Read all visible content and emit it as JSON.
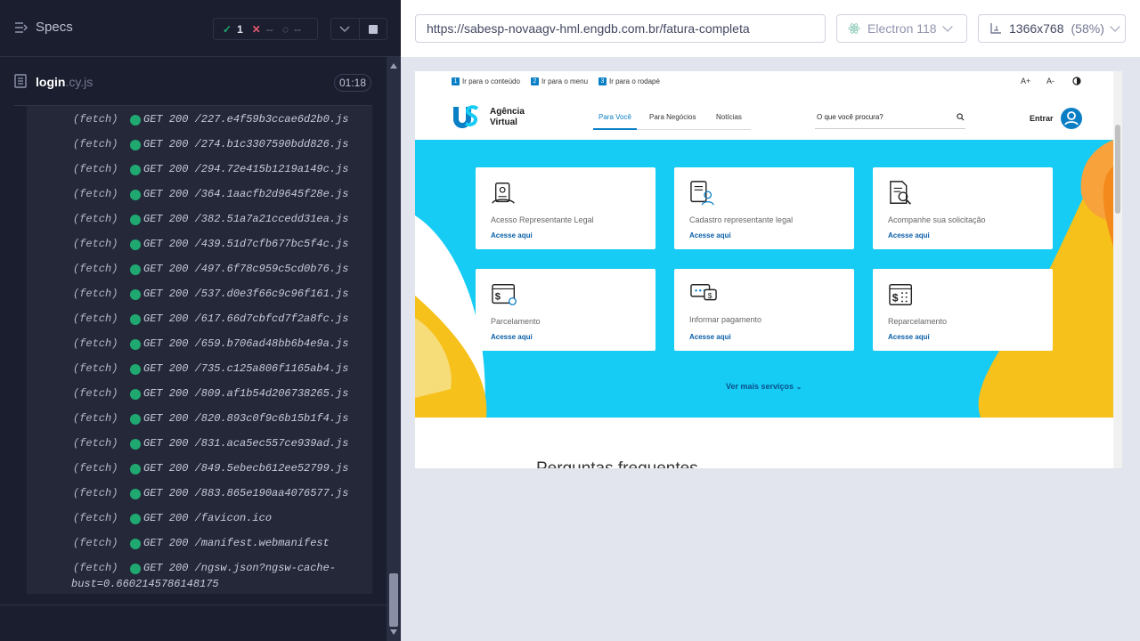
{
  "runner": {
    "specs_label": "Specs",
    "stats": {
      "passed": "1",
      "failed": "--",
      "pending": "--"
    },
    "spec": {
      "name": "login",
      "ext": ".cy.js",
      "duration": "01:18"
    },
    "commands": [
      {
        "type": "(fetch)",
        "msg": "GET 200 /227.e4f59b3ccae6d2b0.js"
      },
      {
        "type": "(fetch)",
        "msg": "GET 200 /274.b1c3307590bdd826.js"
      },
      {
        "type": "(fetch)",
        "msg": "GET 200 /294.72e415b1219a149c.js"
      },
      {
        "type": "(fetch)",
        "msg": "GET 200 /364.1aacfb2d9645f28e.js"
      },
      {
        "type": "(fetch)",
        "msg": "GET 200 /382.51a7a21ccedd31ea.js"
      },
      {
        "type": "(fetch)",
        "msg": "GET 200 /439.51d7cfb677bc5f4c.js"
      },
      {
        "type": "(fetch)",
        "msg": "GET 200 /497.6f78c959c5cd0b76.js"
      },
      {
        "type": "(fetch)",
        "msg": "GET 200 /537.d0e3f66c9c96f161.js"
      },
      {
        "type": "(fetch)",
        "msg": "GET 200 /617.66d7cbfcd7f2a8fc.js"
      },
      {
        "type": "(fetch)",
        "msg": "GET 200 /659.b706ad48bb6b4e9a.js"
      },
      {
        "type": "(fetch)",
        "msg": "GET 200 /735.c125a806f1165ab4.js"
      },
      {
        "type": "(fetch)",
        "msg": "GET 200 /809.af1b54d206738265.js"
      },
      {
        "type": "(fetch)",
        "msg": "GET 200 /820.893c0f9c6b15b1f4.js"
      },
      {
        "type": "(fetch)",
        "msg": "GET 200 /831.aca5ec557ce939ad.js"
      },
      {
        "type": "(fetch)",
        "msg": "GET 200 /849.5ebecb612ee52799.js"
      },
      {
        "type": "(fetch)",
        "msg": "GET 200 /883.865e190aa4076577.js"
      },
      {
        "type": "(fetch)",
        "msg": "GET 200 /favicon.ico"
      },
      {
        "type": "(fetch)",
        "msg": "GET 200 /manifest.webmanifest"
      },
      {
        "type": "(fetch)",
        "msg": "GET 200 /ngsw.json?ngsw-cache-",
        "cont": "bust=0.6602145786148175"
      }
    ]
  },
  "aut": {
    "url": "https://sabesp-novaagv-hml.engdb.com.br/fatura-completa",
    "browser": "Electron 118",
    "viewport": "1366x768",
    "scale": "(58%)"
  },
  "site": {
    "skip_links": [
      {
        "n": "1",
        "label": "Ir para o conteúdo"
      },
      {
        "n": "2",
        "label": "Ir para o menu"
      },
      {
        "n": "3",
        "label": "Ir para o rodapé"
      }
    ],
    "font_up": "A+",
    "font_down": "A-",
    "logo_line1": "Agência",
    "logo_line2": "Virtual",
    "nav": [
      "Para Você",
      "Para Negócios",
      "Notícias"
    ],
    "search_placeholder": "O que você procura?",
    "login_label": "Entrar",
    "cards": [
      {
        "icon": "representative-icon",
        "title": "Acesso Representante Legal",
        "link": "Acesse aqui"
      },
      {
        "icon": "register-representative-icon",
        "title": "Cadastro representante legal",
        "link": "Acesse aqui"
      },
      {
        "icon": "track-request-icon",
        "title": "Acompanhe sua solicitação",
        "link": "Acesse aqui"
      },
      {
        "icon": "installment-icon",
        "title": "Parcelamento",
        "link": "Acesse aqui"
      },
      {
        "icon": "payment-chat-icon",
        "title": "Informar pagamento",
        "link": "Acesse aqui"
      },
      {
        "icon": "calendar-money-icon",
        "title": "Reparcelamento",
        "link": "Acesse aqui"
      }
    ],
    "more_services": "Ver mais serviços",
    "faq_title": "Perguntas frequentes"
  },
  "colors": {
    "hero": "#16ccf4",
    "accent_blue": "#0a7fc6",
    "yellow": "#f6c11a",
    "orange": "#f7a23b",
    "pass_green": "#1fa971"
  }
}
